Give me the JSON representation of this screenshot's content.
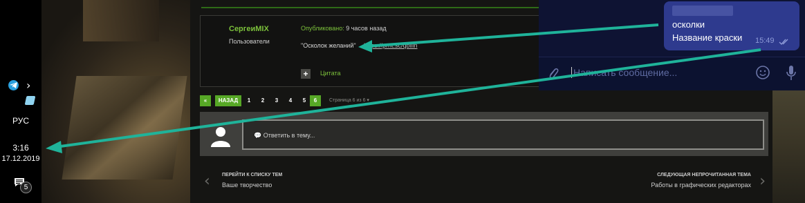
{
  "taskbar": {
    "language": "РУС",
    "time": "3:16",
    "date": "17.12.2019",
    "notification_count": "5",
    "chevron": "›"
  },
  "post": {
    "author": "СергеиMIX",
    "group": "Пользователи",
    "published_label": "Опубликовано:",
    "published_time": "9 часов назад",
    "quote_text": "\"Осколок желаний\"",
    "link": "https://prnt.sc/qbllin",
    "quote_button": "+",
    "quote_label": "Цитата"
  },
  "pagination": {
    "first": "«",
    "prev": "НАЗАД",
    "pages": [
      "1",
      "2",
      "3",
      "4",
      "5",
      "6"
    ],
    "current": "6",
    "page_of": "Страница 6 из 6 ▾"
  },
  "reply": {
    "placeholder": "💬 Ответить в тему..."
  },
  "topic_nav": {
    "prev_title": "ПЕРЕЙТИ К СПИСКУ ТЕМ",
    "prev_sub": "Ваше творчество",
    "next_title": "СЛЕДУЮЩАЯ НЕПРОЧИТАННАЯ ТЕМА",
    "next_sub": "Работы в графических редакторах",
    "prev_arrow": "‹",
    "next_arrow": "›"
  },
  "telegram": {
    "line1": "осколки",
    "line2": "Название краски",
    "time": "15:49",
    "input_placeholder": "Написать сообщение..."
  },
  "colors": {
    "accent_green": "#7cc13b",
    "pager_green": "#57a826",
    "arrow_teal": "#1fb39a",
    "telegram_bubble": "#2e3a8e",
    "telegram_bg": "#0e1333"
  },
  "icons": [
    "telegram-icon",
    "app-icon",
    "notification-icon",
    "avatar-silhouette-icon",
    "paperclip-icon",
    "emoji-icon",
    "microphone-icon",
    "read-ticks-icon"
  ]
}
